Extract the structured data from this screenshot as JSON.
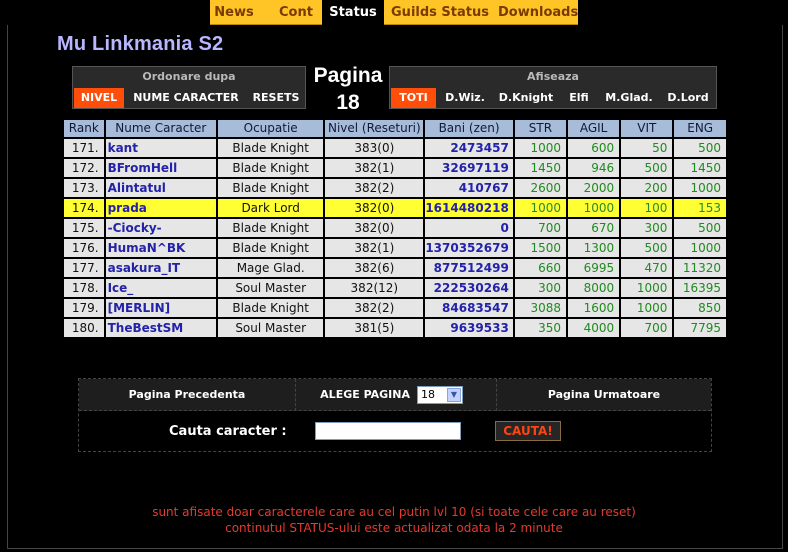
{
  "nav": {
    "items": [
      {
        "label": "News"
      },
      {
        "label": "Cont"
      },
      {
        "label": "Status"
      },
      {
        "label": "Guilds Status"
      },
      {
        "label": "Downloads"
      }
    ],
    "active": "Status"
  },
  "site": {
    "title": "Mu Linkmania S2"
  },
  "sort": {
    "heading": "Ordonare dupa",
    "options": [
      "NIVEL",
      "NUME CARACTER",
      "RESETS"
    ],
    "selected": "NIVEL"
  },
  "page": {
    "label": "Pagina",
    "number": "18"
  },
  "filter": {
    "heading": "Afiseaza",
    "options": [
      "TOTI",
      "D.Wiz.",
      "D.Knight",
      "Elfi",
      "M.Glad.",
      "D.Lord"
    ],
    "selected": "TOTI"
  },
  "table": {
    "headers": [
      "Rank",
      "Nume Caracter",
      "Ocupatie",
      "Nivel (Reseturi)",
      "Bani (zen)",
      "STR",
      "AGIL",
      "VIT",
      "ENG"
    ],
    "rows": [
      {
        "rank": "171.",
        "name": "kant",
        "class": "Blade Knight",
        "level": "383(0)",
        "zen": "2473457",
        "str": "1000",
        "agil": "600",
        "vit": "50",
        "eng": "500"
      },
      {
        "rank": "172.",
        "name": "BFromHell",
        "class": "Blade Knight",
        "level": "382(1)",
        "zen": "32697119",
        "str": "1450",
        "agil": "946",
        "vit": "500",
        "eng": "1450"
      },
      {
        "rank": "173.",
        "name": "Alintatul",
        "class": "Blade Knight",
        "level": "382(2)",
        "zen": "410767",
        "str": "2600",
        "agil": "2000",
        "vit": "200",
        "eng": "1000"
      },
      {
        "rank": "174.",
        "name": "prada",
        "class": "Dark Lord",
        "level": "382(0)",
        "zen": "1614480218",
        "str": "1000",
        "agil": "1000",
        "vit": "100",
        "eng": "153",
        "highlight": true
      },
      {
        "rank": "175.",
        "name": "-Ciocky-",
        "class": "Blade Knight",
        "level": "382(0)",
        "zen": "0",
        "str": "700",
        "agil": "670",
        "vit": "300",
        "eng": "500"
      },
      {
        "rank": "176.",
        "name": "HumaN^BK",
        "class": "Blade Knight",
        "level": "382(1)",
        "zen": "1370352679",
        "str": "1500",
        "agil": "1300",
        "vit": "500",
        "eng": "1000"
      },
      {
        "rank": "177.",
        "name": "asakura_IT",
        "class": "Mage Glad.",
        "level": "382(6)",
        "zen": "877512499",
        "str": "660",
        "agil": "6995",
        "vit": "470",
        "eng": "11320"
      },
      {
        "rank": "178.",
        "name": "Ice_",
        "class": "Soul Master",
        "level": "382(12)",
        "zen": "222530264",
        "str": "300",
        "agil": "8000",
        "vit": "1000",
        "eng": "16395"
      },
      {
        "rank": "179.",
        "name": "[MERLIN]",
        "class": "Blade Knight",
        "level": "382(2)",
        "zen": "84683547",
        "str": "3088",
        "agil": "1600",
        "vit": "1000",
        "eng": "850"
      },
      {
        "rank": "180.",
        "name": "TheBestSM",
        "class": "Soul Master",
        "level": "381(5)",
        "zen": "9639533",
        "str": "350",
        "agil": "4000",
        "vit": "700",
        "eng": "7795"
      }
    ]
  },
  "paging": {
    "prev_label": "Pagina Precedenta",
    "choose_label": "ALEGE PAGINA",
    "selected_page": "18",
    "next_label": "Pagina Urmatoare",
    "search_label": "Cauta caracter :",
    "search_value": "",
    "search_button": "CAUTA!"
  },
  "notes": {
    "line1": "sunt afisate doar caracterele care au cel putin lvl 10 (si toate cele care au reset)",
    "line2": "continutul STATUS-ului este actualizat odata la 2 minute"
  },
  "colors": {
    "nav_bg": "#ffc526",
    "selected_option": "#ff4d0a",
    "header_cell": "#a7bcd8",
    "highlight_row": "#ffff33",
    "note_text": "#e53a2e"
  }
}
